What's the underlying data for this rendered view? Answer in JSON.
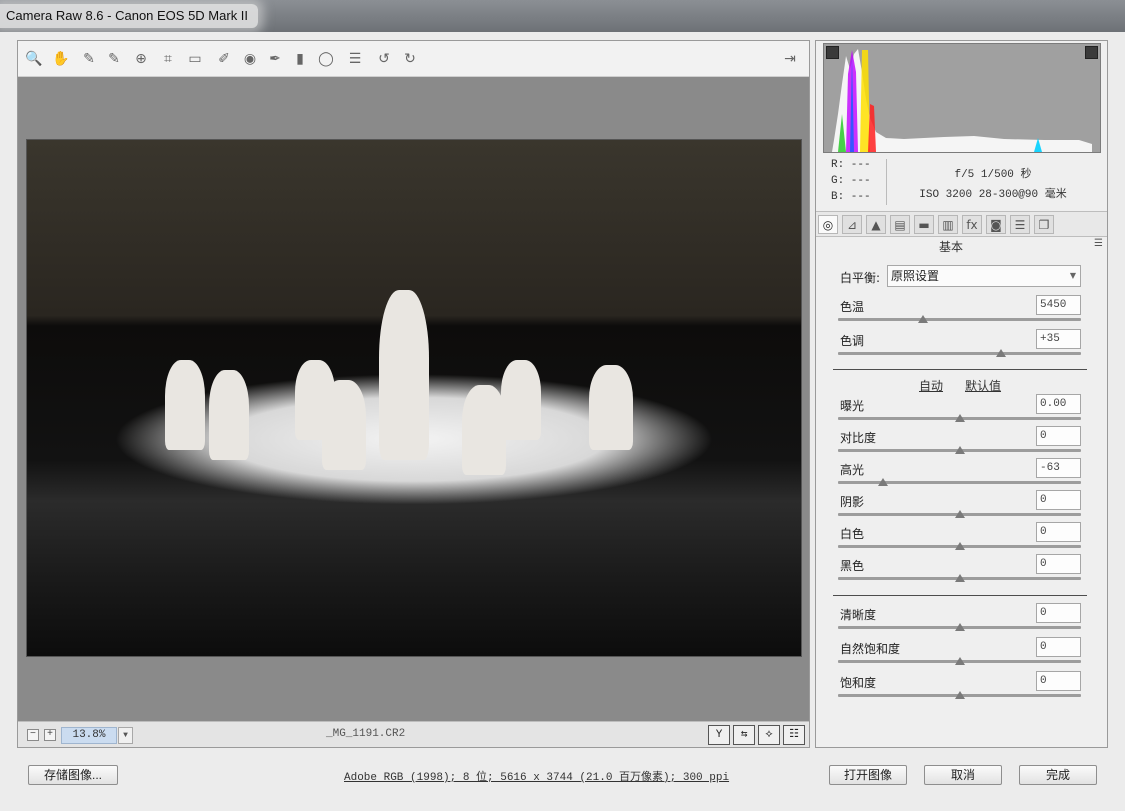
{
  "window": {
    "title": "Camera Raw 8.6 -  Canon EOS 5D Mark II"
  },
  "toolbar": {
    "tools": [
      {
        "name": "zoom-tool-icon",
        "glyph": "🔍"
      },
      {
        "name": "hand-tool-icon",
        "glyph": "✋"
      },
      {
        "name": "white-balance-tool-icon",
        "glyph": "✎"
      },
      {
        "name": "color-sampler-tool-icon",
        "glyph": "✎"
      },
      {
        "name": "targeted-adjustment-tool-icon",
        "glyph": "⊕"
      },
      {
        "name": "crop-tool-icon",
        "glyph": "⌗"
      },
      {
        "name": "straighten-tool-icon",
        "glyph": "▭"
      },
      {
        "name": "spot-removal-tool-icon",
        "glyph": "✐"
      },
      {
        "name": "red-eye-removal-icon",
        "glyph": "◉"
      },
      {
        "name": "adjustment-brush-icon",
        "glyph": "✒"
      },
      {
        "name": "graduated-filter-icon",
        "glyph": "▮"
      },
      {
        "name": "radial-filter-icon",
        "glyph": "◯"
      },
      {
        "name": "preferences-icon",
        "glyph": "☰"
      },
      {
        "name": "rotate-left-icon",
        "glyph": "↺"
      },
      {
        "name": "rotate-right-icon",
        "glyph": "↻"
      }
    ],
    "fullscreen_glyph": "⇥"
  },
  "status": {
    "zoom_value": "13.8%",
    "zoom_minus": "−",
    "zoom_plus": "+",
    "zoom_dropdown": "▼",
    "filename": "_MG_1191.CR2",
    "view_buttons": [
      "Y",
      "⇆",
      "⟡",
      "☷"
    ]
  },
  "info": {
    "r": "R:  ---",
    "g": "G:  ---",
    "b": "B:  ---",
    "exposure": "f/5   1/500 秒",
    "iso_lens": "ISO 3200   28-300@90 毫米"
  },
  "tabs": [
    "◎",
    "⊿",
    "▲",
    "▤",
    "▬",
    "▥",
    "fx",
    "◙",
    "☰",
    "❐"
  ],
  "panel": {
    "section_title": "基本",
    "menu_glyph": "☰",
    "white_balance_label": "白平衡:",
    "white_balance_value": "原照设置",
    "white_balance_arrow": "▼",
    "auto_label": "自动",
    "default_label": "默认值",
    "sliders_wb": [
      {
        "key": "temp",
        "label": "色温",
        "value": "5450",
        "position": 0.35
      },
      {
        "key": "tint",
        "label": "色调",
        "value": "+35",
        "position": 0.67
      }
    ],
    "sliders_tone": [
      {
        "key": "exposure",
        "label": "曝光",
        "value": "0.00",
        "position": 0.5
      },
      {
        "key": "contrast",
        "label": "对比度",
        "value": "0",
        "position": 0.5
      },
      {
        "key": "highlights",
        "label": "高光",
        "value": "-63",
        "position": 0.185
      },
      {
        "key": "shadows",
        "label": "阴影",
        "value": "0",
        "position": 0.5
      },
      {
        "key": "whites",
        "label": "白色",
        "value": "0",
        "position": 0.5
      },
      {
        "key": "blacks",
        "label": "黑色",
        "value": "0",
        "position": 0.5
      }
    ],
    "sliders_presence": [
      {
        "key": "clarity",
        "label": "清晰度",
        "value": "0",
        "position": 0.5
      },
      {
        "key": "vibrance",
        "label": "自然饱和度",
        "value": "0",
        "position": 0.5
      },
      {
        "key": "saturation",
        "label": "饱和度",
        "value": "0",
        "position": 0.5
      }
    ]
  },
  "footer": {
    "save_label": "存储图像...",
    "workflow_text": "Adobe RGB (1998); 8 位; 5616 x 3744 (21.0 百万像素); 300 ppi",
    "open_label": "打开图像",
    "cancel_label": "取消",
    "done_label": "完成"
  }
}
